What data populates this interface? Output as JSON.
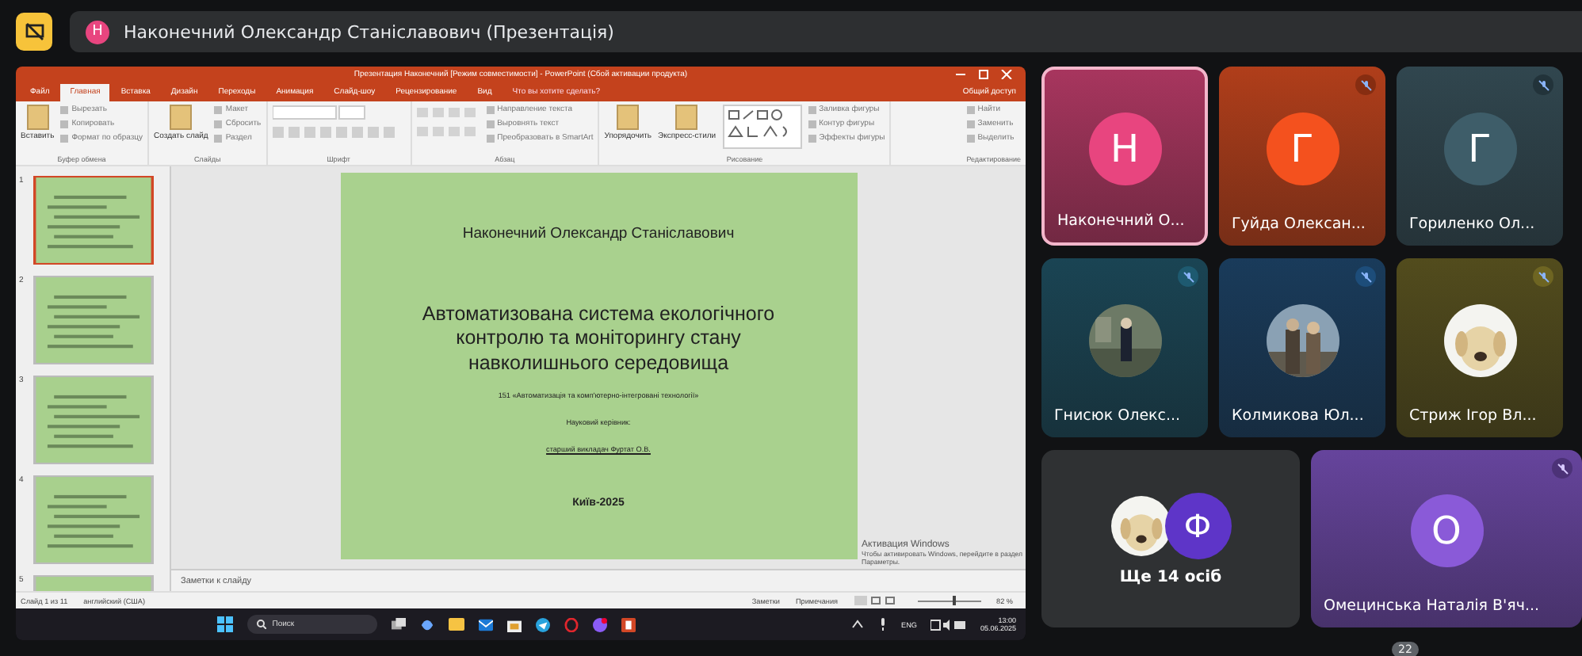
{
  "meet_header": {
    "presenter_initial": "Н",
    "title": "Наконечний Олександр Станіславович (Презентація)"
  },
  "powerpoint": {
    "title": "Презентация Наконечний [Режим совместимости] - PowerPoint (Сбой активации продукта)",
    "tabs": [
      {
        "label": "Файл",
        "selected": false
      },
      {
        "label": "Главная",
        "selected": true
      },
      {
        "label": "Вставка",
        "selected": false
      },
      {
        "label": "Дизайн",
        "selected": false
      },
      {
        "label": "Переходы",
        "selected": false
      },
      {
        "label": "Анимация",
        "selected": false
      },
      {
        "label": "Слайд-шоу",
        "selected": false
      },
      {
        "label": "Рецензирование",
        "selected": false
      },
      {
        "label": "Вид",
        "selected": false
      }
    ],
    "tell_me": "Что вы хотите сделать?",
    "share": "Общий доступ",
    "ribbon_groups": [
      {
        "label": "Буфер обмена",
        "kind": "clipboard",
        "large": [
          "Вставить"
        ],
        "small": [
          "Вырезать",
          "Копировать",
          "Формат по образцу"
        ]
      },
      {
        "label": "Слайды",
        "kind": "slides",
        "large": [
          "Создать слайд"
        ],
        "small": [
          "Макет",
          "Сбросить",
          "Раздел"
        ]
      },
      {
        "label": "Шрифт",
        "kind": "font"
      },
      {
        "label": "Абзац",
        "kind": "paragraph",
        "small": [
          "Направление текста",
          "Выровнять текст",
          "Преобразовать в SmartArt"
        ]
      },
      {
        "label": "Рисование",
        "kind": "drawing",
        "large": [
          "Упорядочить",
          "Экспресс-стили"
        ],
        "small": [
          "Заливка фигуры",
          "Контур фигуры",
          "Эффекты фигуры"
        ]
      },
      {
        "label": "Редактирование",
        "kind": "editing",
        "small": [
          "Найти",
          "Заменить",
          "Выделить"
        ]
      }
    ],
    "thumbnails": [
      {
        "number": "1",
        "selected": true
      },
      {
        "number": "2",
        "selected": false
      },
      {
        "number": "3",
        "selected": false
      },
      {
        "number": "4",
        "selected": false
      },
      {
        "number": "5",
        "selected": false
      }
    ],
    "slide": {
      "author": "Наконечний Олександр Станіславович",
      "title": "Автоматизована система екологічного контролю та моніторингу стану навколишнього середовища",
      "specialty": "151 «Автоматизація та комп'ютерно-інтегровані технології»",
      "supervisor_label": "Науковий керівник:",
      "supervisor": "старший викладач Фуртат О.В.",
      "footer": "Київ-2025"
    },
    "notes_placeholder": "Заметки к слайду",
    "activation_notice": [
      "Активация Windows",
      "Чтобы активировать Windows, перейдите в раздел",
      "Параметры."
    ],
    "status_bar": {
      "slide_counter": "Слайд 1 из 11",
      "language": "английский (США)",
      "notes": "Заметки",
      "comments": "Примечания",
      "zoom": {
        "label": "82 %",
        "level": 0.55
      }
    },
    "taskbar": {
      "search_placeholder": "Поиск",
      "language": "ENG",
      "time": "13:00",
      "date": "05.06.2025"
    }
  },
  "participants": [
    {
      "name": "Наконечний О...",
      "kind": "initial",
      "initial": "Н",
      "color": "#e8457f",
      "muted": false,
      "speaking": true
    },
    {
      "name": "Гуйда Олексан...",
      "kind": "initial",
      "initial": "Г",
      "color": "#f4511e",
      "muted": true,
      "speaking": false
    },
    {
      "name": "Гориленко Ол...",
      "kind": "initial",
      "initial": "Г",
      "color": "#3e5d69",
      "muted": true,
      "speaking": false
    },
    {
      "name": "Гнисюк Олекс...",
      "color": "#1e5a70",
      "muted": true,
      "speaking": false
    },
    {
      "name": "Колмикова Юл...",
      "color": "#1d4d7a",
      "muted": true,
      "speaking": false
    },
    {
      "name": "Стриж Ігор Вл...",
      "color": "#6e6522",
      "muted": true,
      "speaking": false
    }
  ],
  "others": {
    "label": "Ще 14 осіб",
    "initial": "Ф",
    "color": "#5e35c8"
  },
  "featured": {
    "name": "Омецинська Наталія В'яч...",
    "initial": "О",
    "color": "#8a5ad8",
    "muted": true
  },
  "participant_count": "22"
}
